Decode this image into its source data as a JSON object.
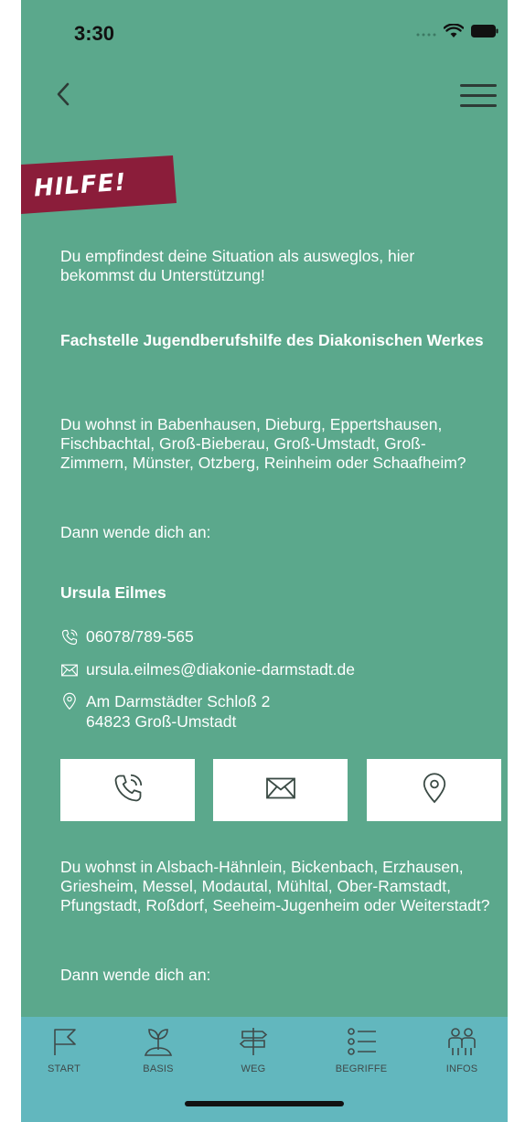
{
  "status_bar": {
    "time": "3:30"
  },
  "nav": {
    "back_icon": "chevron-left-icon",
    "menu_icon": "hamburger-menu-icon"
  },
  "banner": {
    "title": "HILFE!",
    "color": "#8b1d3a"
  },
  "content": {
    "intro": "Du empfindest deine Situation als ausweglos, hier bekommst du Unterstützung!",
    "org_name": "Fachstelle Jugendberufshilfe des Diakonischen Werkes",
    "region_1": "Du wohnst in Babenhausen, Dieburg, Eppertshausen, Fischbachtal, Groß-Bieberau, Groß-Umstadt, Groß-Zimmern, Münster, Otzberg, Reinheim oder Schaafheim?",
    "contact_prompt_1": "Dann wende dich an:",
    "person_name": "Ursula Eilmes",
    "phone": "06078/789-565",
    "email": "ursula.eilmes@diakonie-darmstadt.de",
    "address_line1": "Am Darmstädter Schloß 2",
    "address_line2": "64823 Groß-Umstadt",
    "region_2": "Du wohnst in Alsbach-Hähnlein, Bickenbach, Erzhausen, Griesheim, Messel, Modautal, Mühltal, Ober-Ramstadt, Pfungstadt, Roßdorf, Seeheim-Jugenheim oder Weiterstadt?",
    "contact_prompt_2": "Dann wende dich an:"
  },
  "actions": [
    {
      "icon": "phone-icon"
    },
    {
      "icon": "mail-icon"
    },
    {
      "icon": "location-pin-icon"
    }
  ],
  "tabs": [
    {
      "label": "START",
      "icon": "flag-icon"
    },
    {
      "label": "BASIS",
      "icon": "sprout-icon"
    },
    {
      "label": "WEG",
      "icon": "signpost-icon"
    },
    {
      "label": "BEGRIFFE",
      "icon": "list-icon"
    },
    {
      "label": "INFOS",
      "icon": "people-icon"
    }
  ],
  "colors": {
    "background": "#5ba88c",
    "tab_bar": "#62b7be",
    "text": "#ffffff"
  }
}
